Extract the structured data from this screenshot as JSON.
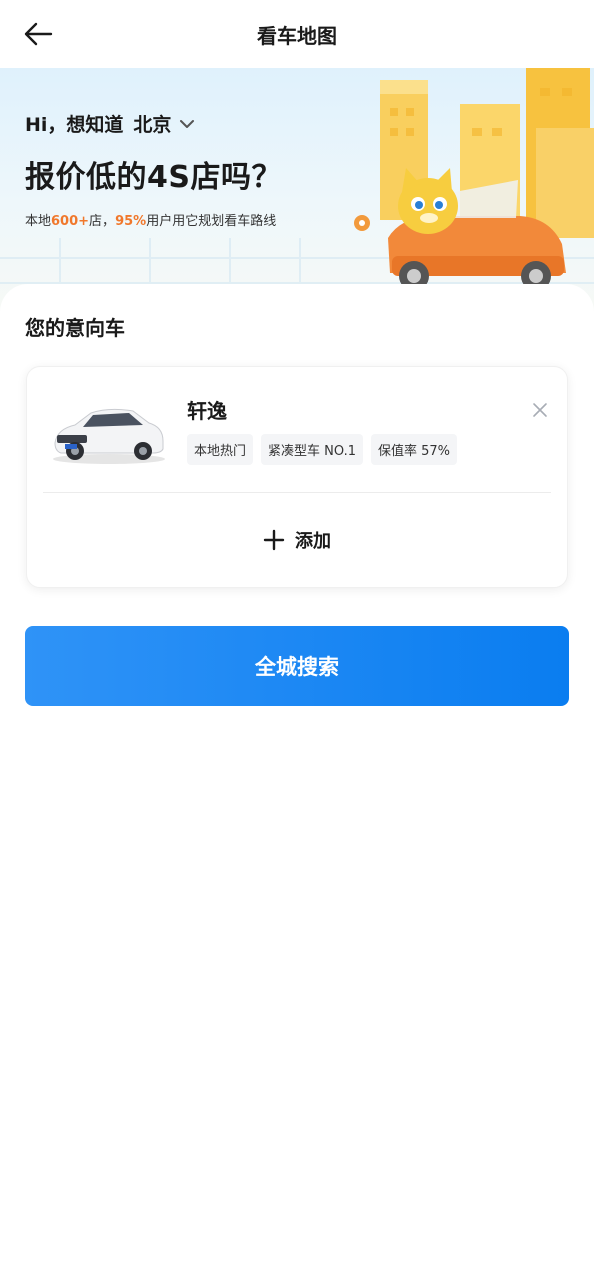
{
  "nav": {
    "title": "看车地图"
  },
  "banner": {
    "greet_prefix": "Hi，想知道",
    "city": "北京",
    "headline": "报价低的4S店吗？",
    "sub_a": "本地",
    "sub_stores": "600+",
    "sub_b": "店，",
    "sub_pct": "95%",
    "sub_c": "用户用它规划看车路线"
  },
  "intent": {
    "title": "您的意向车",
    "car": {
      "name": "轩逸",
      "tags": [
        "本地热门",
        "紧凑型车 NO.1",
        "保值率 57%"
      ]
    },
    "add_label": "添加"
  },
  "search_button": "全城搜索",
  "colors": {
    "accent": "#0a7df0",
    "highlight": "#f0782c"
  }
}
